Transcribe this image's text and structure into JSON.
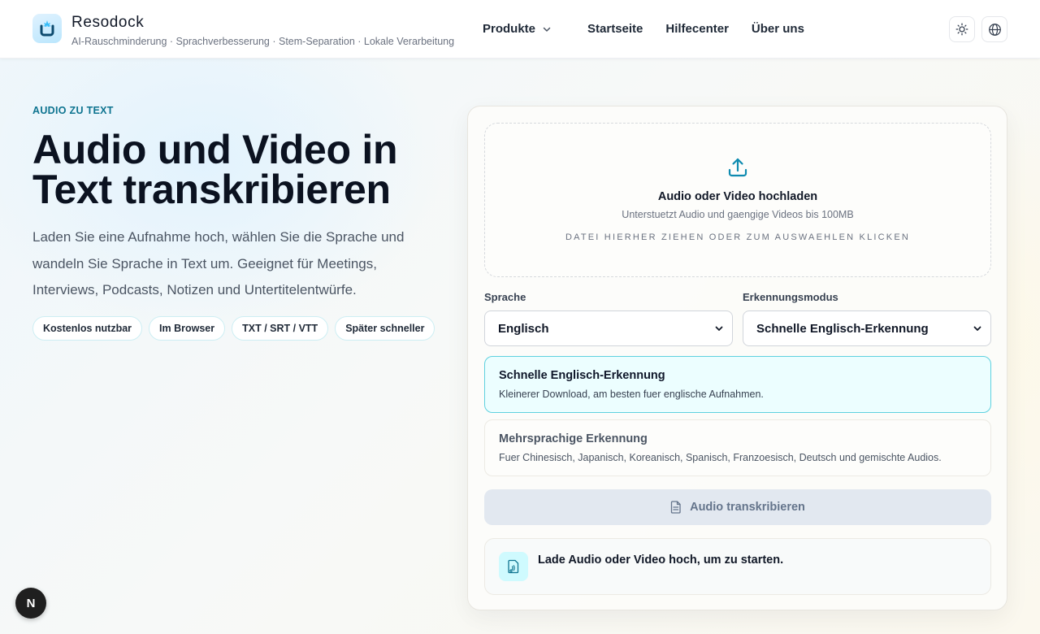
{
  "header": {
    "brand_name": "Resodock",
    "tagline": "AI-Rauschminderung · Sprachverbesserung · Stem-Separation · Lokale Verarbeitung",
    "nav": {
      "products": "Produkte",
      "home": "Startseite",
      "help": "Hilfecenter",
      "about": "Über uns"
    },
    "icons": {
      "theme": "sun-icon",
      "language": "globe-icon",
      "products_dropdown": "chevron-down-icon"
    }
  },
  "hero": {
    "eyebrow": "AUDIO ZU TEXT",
    "title_line1": "Audio und Video in",
    "title_line2": "Text transkribieren",
    "description": "Laden Sie eine Aufnahme hoch, wählen Sie die Sprache und wandeln Sie Sprache in Text um. Geeignet für Meetings, Interviews, Podcasts, Notizen und Untertitelentwürfe.",
    "chips": [
      "Kostenlos nutzbar",
      "Im Browser",
      "TXT / SRT / VTT",
      "Später schneller"
    ]
  },
  "upload": {
    "title": "Audio oder Video hochladen",
    "subtitle": "Unterstuetzt Audio und gaengige Videos bis 100MB",
    "hint": "DATEI HIERHER ZIEHEN ODER ZUM AUSWAEHLEN KLICKEN"
  },
  "form": {
    "language_label": "Sprache",
    "language_value": "Englisch",
    "mode_label": "Erkennungsmodus",
    "mode_value": "Schnelle Englisch-Erkennung"
  },
  "options": [
    {
      "title": "Schnelle Englisch-Erkennung",
      "description": "Kleinerer Download, am besten fuer englische Aufnahmen.",
      "selected": true
    },
    {
      "title": "Mehrsprachige Erkennung",
      "description": "Fuer Chinesisch, Japanisch, Koreanisch, Spanisch, Franzoesisch, Deutsch und gemischte Audios.",
      "selected": false
    }
  ],
  "actions": {
    "transcribe": "Audio transkribieren"
  },
  "status": {
    "message": "Lade Audio oder Video hoch, um zu starten."
  },
  "badge": {
    "label": "N"
  },
  "colors": {
    "accent": "#0e7490",
    "selected_border": "#5fd1df",
    "selected_bg": "#ecfeff",
    "disabled_button": "#e2e8f0"
  }
}
